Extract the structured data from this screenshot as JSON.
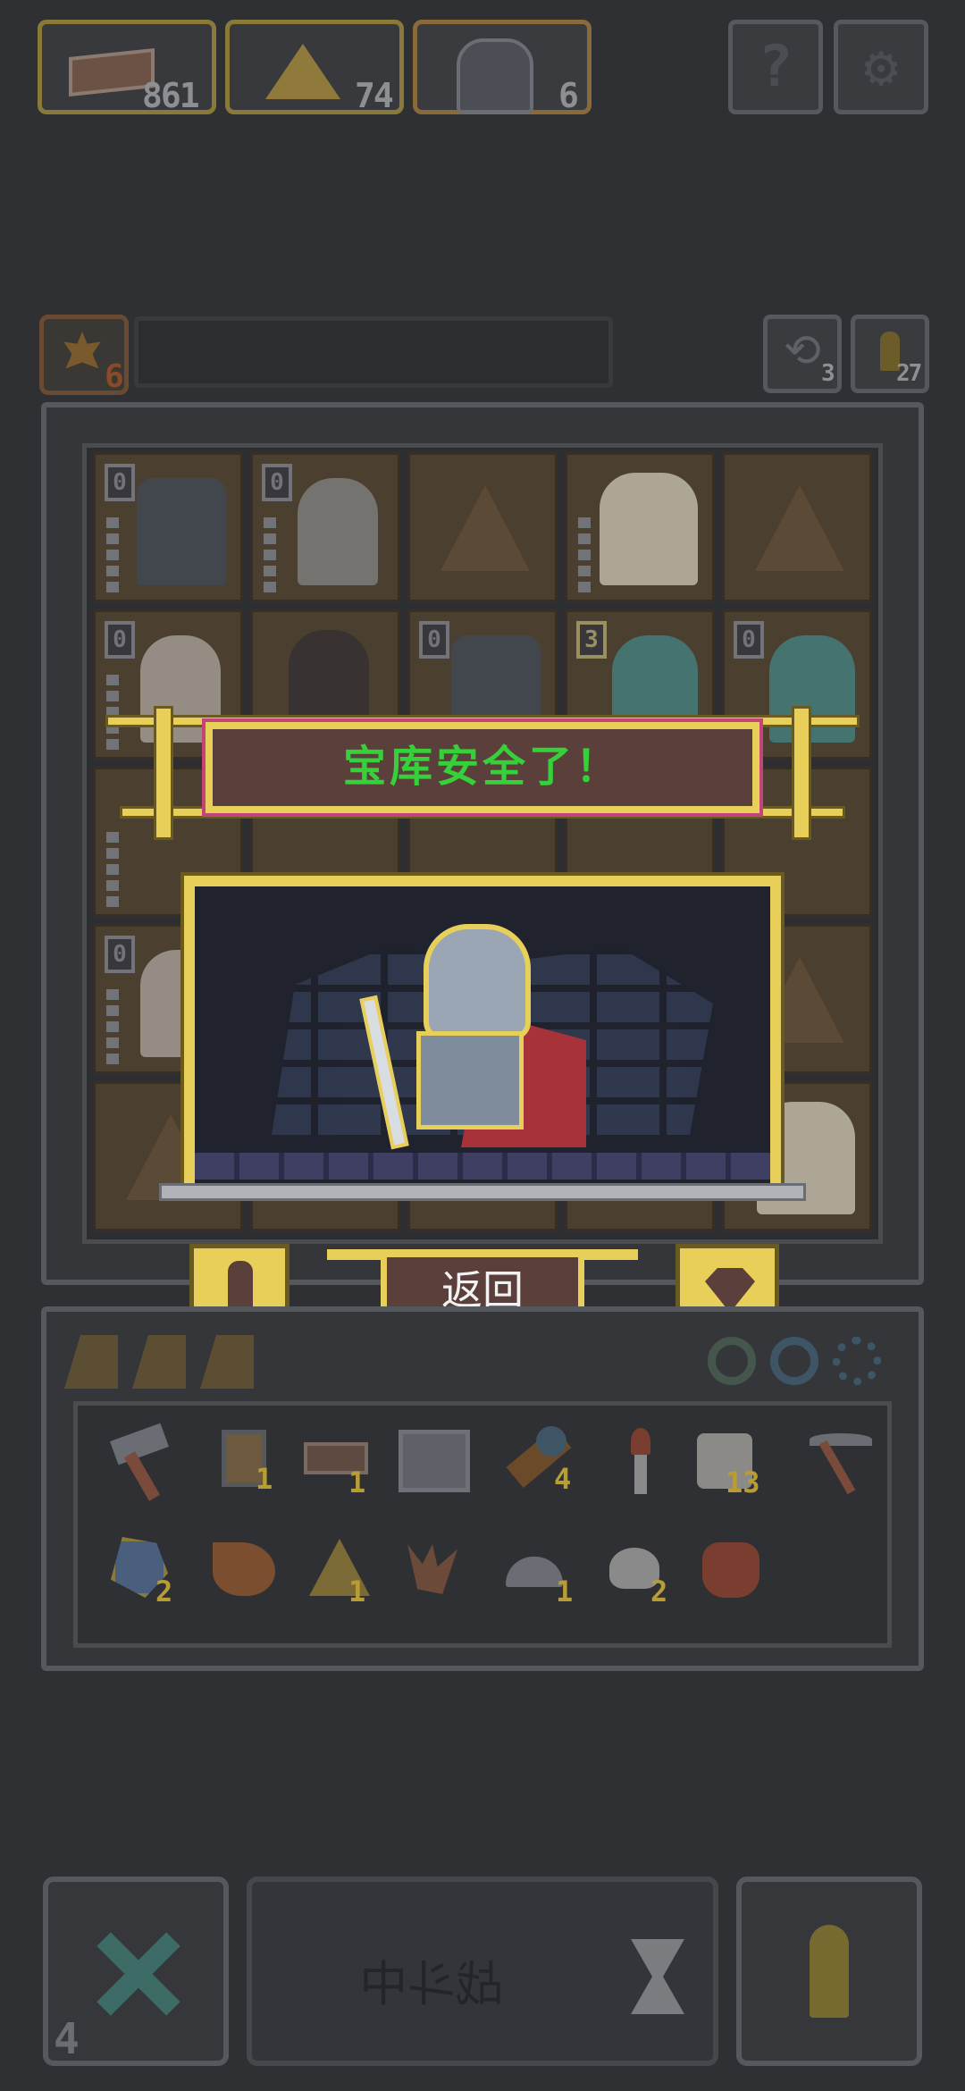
{
  "top_bar": {
    "resource_wood": {
      "icon": "wood-plank-icon",
      "count": "861"
    },
    "resource_gold": {
      "icon": "gold-pile-icon",
      "count": "74"
    },
    "resource_heroes": {
      "icon": "ninja-portrait-icon",
      "count": "6"
    },
    "help_icon": "question-mark-icon",
    "settings_icon": "gear-icon"
  },
  "board_header": {
    "leaf_count": "6",
    "undo_count": "3",
    "unit_count": "27"
  },
  "popup": {
    "title": "宝库安全了！",
    "back_button": "返回",
    "title_color": "#36d13a"
  },
  "inventory_counts": [
    "1",
    "1",
    "4",
    "13",
    "2",
    "1",
    "1",
    "2"
  ],
  "bottom_bar": {
    "status": "战斗中",
    "turn_count": "4"
  },
  "colors": {
    "background": "#2f3033",
    "gold_frame": "#e8cf5a",
    "panel_brown": "#5a3f3a",
    "scene_bg": "#20222e"
  }
}
